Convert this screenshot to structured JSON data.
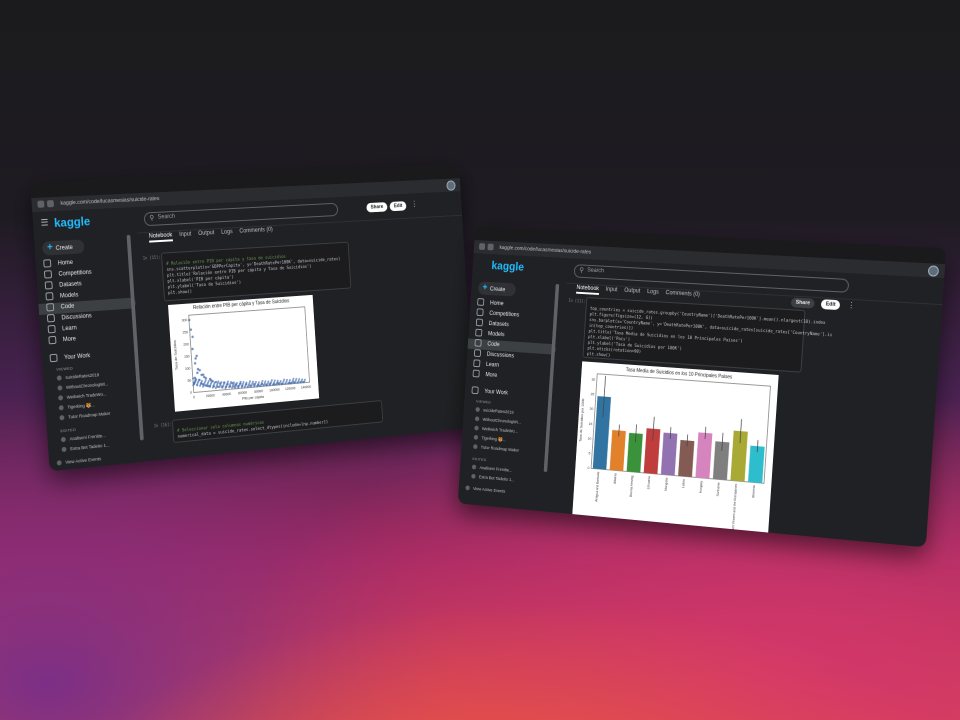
{
  "left_window": {
    "url": "kaggle.com/code/lucasmesias/suicide-rates",
    "logo": "kaggle",
    "search_placeholder": "Search",
    "share_label": "Share",
    "edit_label": "Edit",
    "create_label": "Create",
    "nav": [
      "Home",
      "Competitions",
      "Datasets",
      "Models",
      "Code",
      "Discussions",
      "Learn",
      "More"
    ],
    "active_nav": "Code",
    "your_work_label": "Your Work",
    "viewed_label": "VIEWED",
    "viewed_items": [
      "suicideRates2019",
      "WithoutChronologWi...",
      "Weikwich TradeWo...",
      "Tigerking 🐯...",
      "Tutor Roadmap Maker"
    ],
    "edited_label": "EDITED",
    "edited_items": [
      "Analiseni Frenitte...",
      "Extra Bet Tadeito 1..."
    ],
    "view_active_events": "View Active Events",
    "tabs": [
      "Notebook",
      "Input",
      "Output",
      "Logs",
      "Comments (0)"
    ],
    "active_tab": "Notebook",
    "cell1_exec": "In [15]:",
    "cell1_code": [
      "# Relación entre PIB per cápita y tasa de suicidios",
      "sns.scatterplot(x='GDPPerCapita', y='DeathRatePer100K', data=suicide_rates)",
      "plt.title('Relación entre PIB per cápita y Tasa de Suicidios')",
      "plt.xlabel('PIB per cápita')",
      "plt.ylabel('Tasa de Suicidios')",
      "plt.show()"
    ],
    "cell2_exec": "In [16]:",
    "cell2_code": [
      "# Seleccionar solo columnas numéricas",
      "numerical_data = suicide_rates.select_dtypes(include=[np.number])"
    ],
    "scatter_chart": {
      "title": "Relación entre PIB per cápita y Tasa de Suicidios",
      "xlabel": "PIB per cápita",
      "ylabel": "Tasa de Suicidios",
      "xticks": [
        "0",
        "20000",
        "40000",
        "60000",
        "80000",
        "100000",
        "120000",
        "140000"
      ],
      "yticks": [
        "0",
        "50",
        "100",
        "150",
        "200",
        "250",
        "300"
      ]
    }
  },
  "right_window": {
    "url": "kaggle.com/code/lucasmesias/suicide-rates",
    "logo": "kaggle",
    "search_placeholder": "Search",
    "share_label": "Share",
    "edit_label": "Edit",
    "create_label": "Create",
    "nav": [
      "Home",
      "Competitions",
      "Datasets",
      "Models",
      "Code",
      "Discussions",
      "Learn",
      "More"
    ],
    "active_nav": "Code",
    "your_work_label": "Your Work",
    "viewed_label": "VIEWED",
    "viewed_items": [
      "suicideRates2019",
      "WithoutChronologWi...",
      "Weikwich TradeWo...",
      "Tigerking 🐯...",
      "Tutor Roadmap Maker"
    ],
    "edited_label": "EDITED",
    "edited_items": [
      "Analiseni Frenitte...",
      "Extra Bet Tadeito 1..."
    ],
    "view_active_events": "View Active Events",
    "tabs": [
      "Notebook",
      "Input",
      "Output",
      "Logs",
      "Comments (0)"
    ],
    "active_tab": "Notebook",
    "cell_exec": "In [11]:",
    "cell_code": [
      "top_countries = suicide_rates.groupby('CountryName')['DeathRatePer100K'].mean().nlargest(10).index",
      "plt.figure(figsize=(12, 6))",
      "sns.barplot(x='CountryName', y='DeathRatePer100K', data=suicide_rates[suicide_rates['CountryName'].is",
      "in(top_countries)])",
      "plt.title('Tasa Media de Suicidios en los 10 Principales Países')",
      "plt.xlabel('País')",
      "plt.ylabel('Tasa de Suicidios por 100K')",
      "plt.xticks(rotation=90)",
      "plt.show()"
    ],
    "bar_chart": {
      "title": "Tasa Media de Suicidios en los 10 Principales Países",
      "ylabel": "Tasa de Suicidios por 100K",
      "yticks": [
        "0",
        "5",
        "10",
        "15",
        "20",
        "25",
        "30"
      ]
    }
  },
  "chart_data": [
    {
      "type": "scatter",
      "title": "Relación entre PIB per cápita y Tasa de Suicidios",
      "xlabel": "PIB per cápita",
      "ylabel": "Tasa de Suicidios",
      "xlim": [
        0,
        145000
      ],
      "ylim": [
        0,
        320
      ],
      "color": "#4c72b0",
      "note_series": "dense cloud decreasing with GDP",
      "x": [
        1000,
        2500,
        4000,
        6000,
        8000,
        10000,
        12000,
        15000,
        18000,
        20000,
        25000,
        30000,
        35000,
        40000,
        45000,
        50000,
        55000,
        60000,
        70000,
        80000,
        90000,
        100000,
        110000,
        120000,
        2000,
        5000,
        9000,
        14000,
        22000,
        28000,
        33000,
        42000,
        52000,
        65000,
        75000,
        95000,
        3000,
        7000,
        11000,
        16000,
        24000,
        38000,
        48000,
        58000,
        85000,
        105000,
        125000,
        6500,
        13000,
        21000,
        300,
        1500
      ],
      "y": [
        40,
        60,
        120,
        80,
        50,
        35,
        30,
        25,
        22,
        20,
        18,
        15,
        14,
        12,
        12,
        10,
        10,
        9,
        8,
        8,
        6,
        5,
        4,
        3,
        180,
        140,
        90,
        60,
        45,
        35,
        28,
        22,
        18,
        15,
        12,
        9,
        230,
        95,
        70,
        55,
        40,
        30,
        25,
        20,
        10,
        8,
        6,
        150,
        70,
        50,
        300,
        260
      ]
    },
    {
      "type": "bar",
      "title": "Tasa Media de Suicidios en los 10 Principales Países",
      "xlabel": "",
      "ylabel": "Tasa de Suicidios por 100K",
      "ylim": [
        0,
        32
      ],
      "categories": [
        "Antigua and Barbuda",
        "Albania",
        "Bosnia Herzeg.",
        "Lithuania",
        "Mongolia",
        "Latvia",
        "Hungary",
        "Suriname",
        "Saint Vincent and the Grenadines",
        "Slovenia"
      ],
      "values": [
        24.5,
        13.5,
        13.0,
        15.0,
        14.0,
        12.0,
        15.0,
        12.5,
        16.5,
        12.0
      ],
      "errors": [
        7,
        2,
        3,
        4,
        2,
        2,
        2,
        3,
        4,
        2
      ],
      "colors": [
        "#3274a1",
        "#e1812c",
        "#3a923a",
        "#c03d3e",
        "#9372b2",
        "#845b53",
        "#d684bd",
        "#7f7f7f",
        "#a9aa35",
        "#2ebdcc"
      ]
    }
  ]
}
